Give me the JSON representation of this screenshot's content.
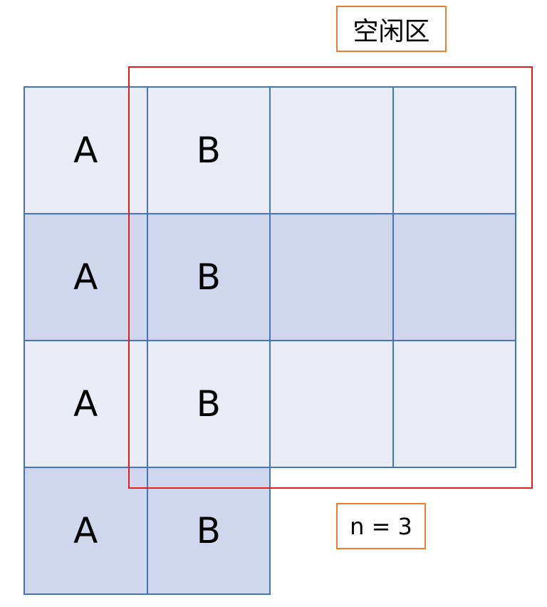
{
  "diagram": {
    "free_area_label": "空闲区",
    "n_label": "n = 3",
    "colors": {
      "cell_border": "#4472C4",
      "row_fill_light": "#E9ECF5",
      "row_fill_dark": "#D0D6EB",
      "free_region_border": "#E01E1E",
      "label_border": "#ED7D31"
    },
    "grid": {
      "rows": [
        {
          "cells": [
            "A",
            "B",
            "",
            ""
          ],
          "shade": "light"
        },
        {
          "cells": [
            "A",
            "B",
            "",
            ""
          ],
          "shade": "dark"
        },
        {
          "cells": [
            "A",
            "B",
            "",
            ""
          ],
          "shade": "light"
        },
        {
          "cells": [
            "A",
            "B"
          ],
          "shade": "dark"
        }
      ]
    }
  }
}
